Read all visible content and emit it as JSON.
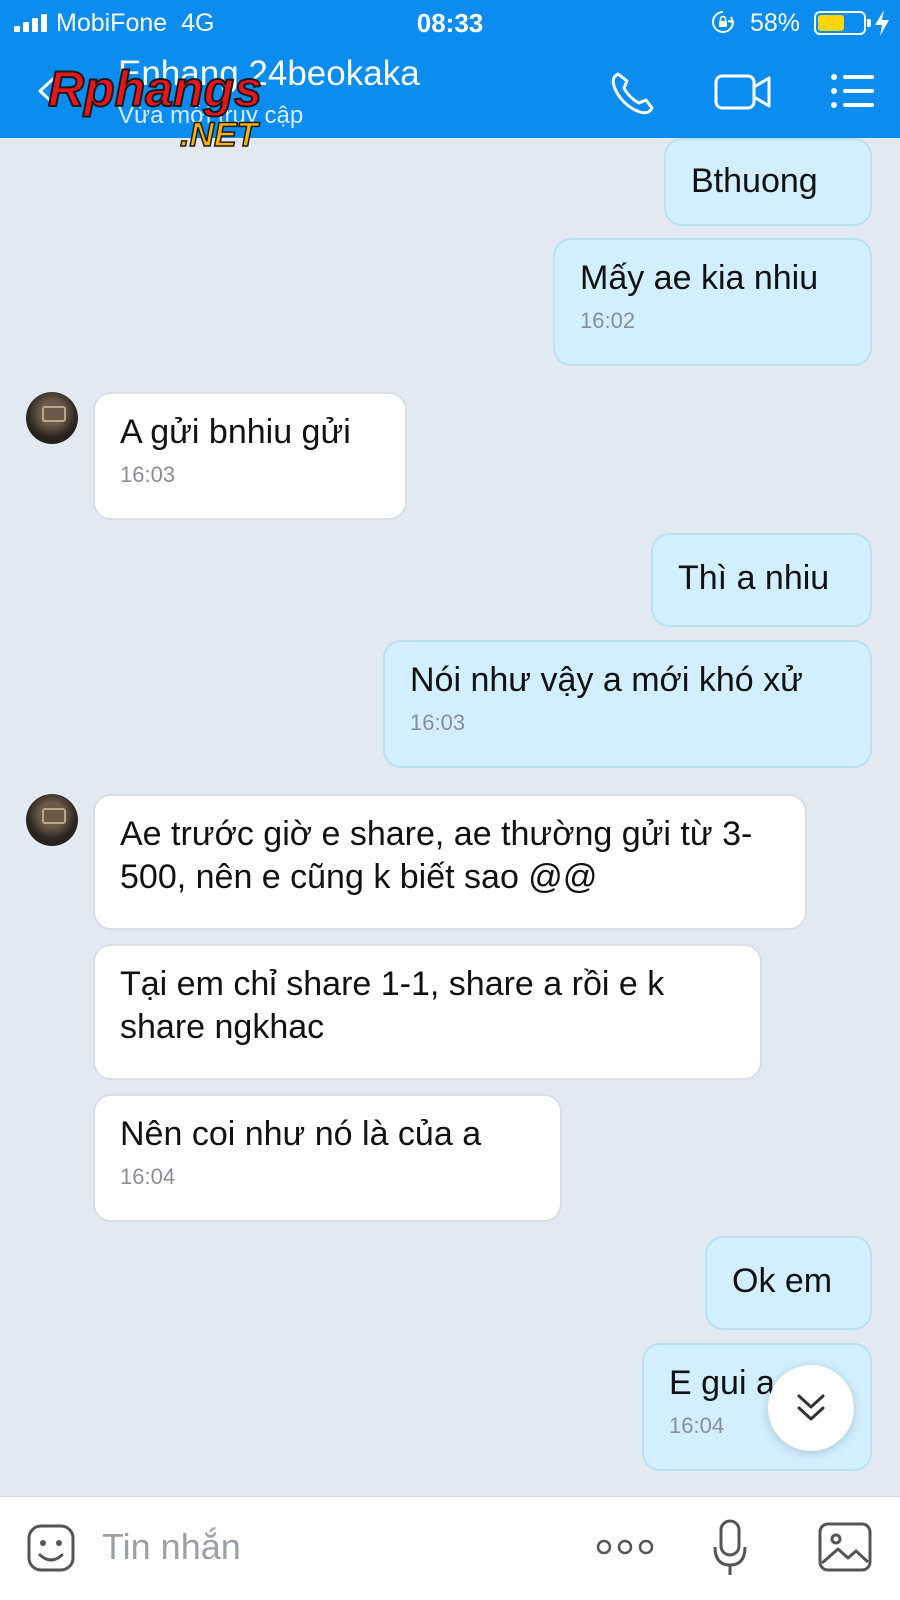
{
  "status_bar": {
    "carrier": "MobiFone",
    "network": "4G",
    "time": "08:33",
    "battery_percent": "58%",
    "battery_level": 0.58
  },
  "header": {
    "contact_name": "Enhang 24beokaka",
    "contact_status": "Vừa mới truy cập",
    "watermark": "Rphangs.NET",
    "icons": [
      "back-icon",
      "call-icon",
      "video-call-icon",
      "menu-icon"
    ]
  },
  "messages": [
    {
      "dir": "out",
      "text": "Bthuong",
      "time": ""
    },
    {
      "dir": "out",
      "text": "Mấy ae kia nhiu",
      "time": "16:02"
    },
    {
      "dir": "in",
      "text": "A gửi bnhiu gửi",
      "time": "16:03"
    },
    {
      "dir": "out",
      "text": "Thì a nhiu",
      "time": ""
    },
    {
      "dir": "out",
      "text": "Nói như vậy a mới khó xử",
      "time": "16:03"
    },
    {
      "dir": "in",
      "text": "Ae trước giờ e share, ae thường gửi từ 3-500, nên e cũng k biết sao @@",
      "time": ""
    },
    {
      "dir": "in",
      "text": "Tại em chỉ share 1-1, share a rồi e k share ngkhac",
      "time": ""
    },
    {
      "dir": "in",
      "text": "Nên coi như nó là của a",
      "time": "16:04"
    },
    {
      "dir": "out",
      "text": "Ok em",
      "time": ""
    },
    {
      "dir": "out",
      "text": "E gui a",
      "time": "16:04"
    }
  ],
  "input_bar": {
    "placeholder": "Tin nhắn",
    "icons": [
      "emoji-icon",
      "more-icon",
      "microphone-icon",
      "image-icon"
    ]
  },
  "colors": {
    "header_bg": "#0a8cf0",
    "chat_bg": "#e2e9f1",
    "outgoing_bubble": "#d2efff",
    "incoming_bubble": "#ffffff",
    "battery_fill": "#ffd60a"
  }
}
